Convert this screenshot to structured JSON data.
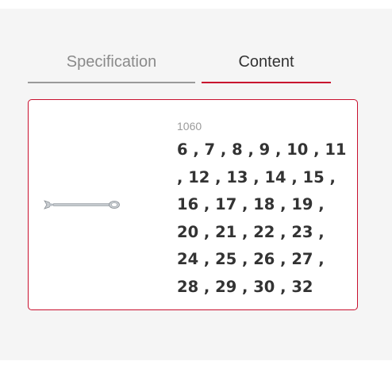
{
  "tabs": {
    "specification": "Specification",
    "content": "Content"
  },
  "product": {
    "code": "1060",
    "sizes_text": "6 , 7 , 8 , 9 , 10 , 11 , 12 , 13 , 14 , 15 , 16 , 17 , 18 , 19 , 20 , 21 , 22 , 23 , 24 , 25 , 26 , 27 , 28 , 29 , 30 , 32",
    "image_icon": "combination-wrench-icon"
  },
  "colors": {
    "accent": "#c8102e",
    "panel_bg": "#f5f5f5",
    "muted_text": "#8a8a8a",
    "text": "#333333"
  }
}
